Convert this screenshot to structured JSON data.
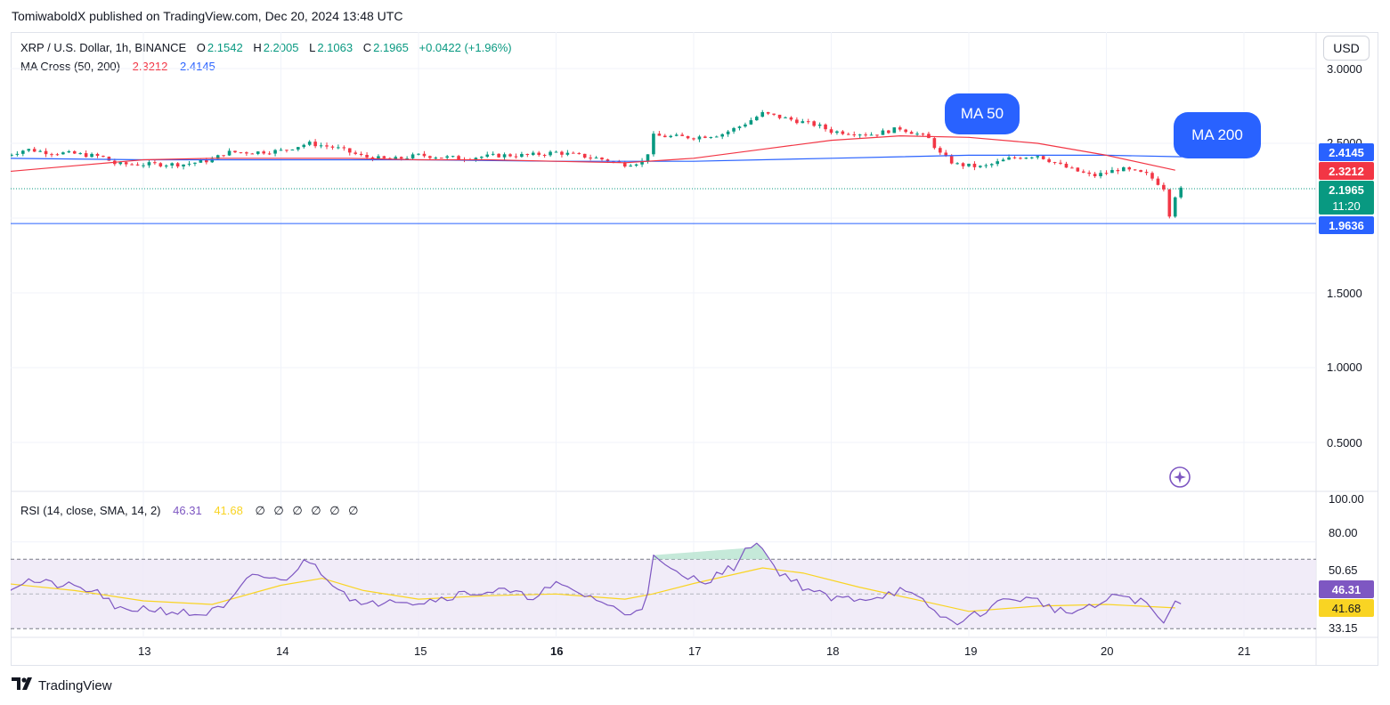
{
  "attribution": "TomiwaboldX published on TradingView.com, Dec 20, 2024 13:48 UTC",
  "header": {
    "symbol": "XRP / U.S. Dollar, 1h, BINANCE",
    "o_label": "O",
    "o_value": "2.1542",
    "h_label": "H",
    "h_value": "2.2005",
    "l_label": "L",
    "l_value": "2.1063",
    "c_label": "C",
    "c_value": "2.1965",
    "change": "+0.0422 (+1.96%)"
  },
  "ma_legend": {
    "label": "MA Cross (50, 200)",
    "ma50": "2.3212",
    "ma200": "2.4145"
  },
  "currency_button": "USD",
  "price_axis": [
    "3.0000",
    "2.5000",
    "1.5000",
    "1.0000",
    "0.5000"
  ],
  "price_tags": {
    "ma200": "2.4145",
    "ma50": "2.3212",
    "last": "2.1965",
    "countdown": "11:20",
    "line": "1.9636"
  },
  "bubbles": {
    "ma50": "MA 50",
    "ma200": "MA 200"
  },
  "rsi_legend": {
    "label": "RSI (14, close, SMA, 14, 2)",
    "rsi": "46.31",
    "sma": "41.68",
    "empties": "∅ ∅ ∅ ∅ ∅ ∅"
  },
  "rsi_axis": [
    "100.00",
    "80.00",
    "50.65",
    "33.15"
  ],
  "rsi_tags": {
    "rsi": "46.31",
    "sma": "41.68"
  },
  "time_axis": [
    "13",
    "14",
    "15",
    "16",
    "17",
    "18",
    "19",
    "20",
    "21"
  ],
  "footer_brand": "TradingView",
  "colors": {
    "up": "#089981",
    "down": "#f23645",
    "ma50": "#f23645",
    "ma200": "#2962ff",
    "rsi": "#7e57c2",
    "rsi_sma": "#f9d423",
    "rsi_band": "#ede7f6",
    "accent": "#2962ff"
  },
  "chart_data": {
    "type": "candlestick",
    "price_ylim": [
      0.25,
      3.1
    ],
    "rsi_ylim": [
      25,
      105
    ],
    "rsi_band": [
      30,
      70
    ],
    "x_start": "2024-12-12",
    "x_ticks": [
      "13",
      "14",
      "15",
      "16",
      "17",
      "18",
      "19",
      "20",
      "21"
    ],
    "horizontal_line": 1.9636,
    "ma50_series": [
      [
        12.0,
        2.31
      ],
      [
        12.5,
        2.35
      ],
      [
        13.0,
        2.39
      ],
      [
        13.5,
        2.4
      ],
      [
        14.0,
        2.4
      ],
      [
        14.5,
        2.4
      ],
      [
        15.0,
        2.39
      ],
      [
        15.5,
        2.39
      ],
      [
        16.0,
        2.38
      ],
      [
        16.5,
        2.37
      ],
      [
        17.0,
        2.4
      ],
      [
        17.5,
        2.46
      ],
      [
        18.0,
        2.52
      ],
      [
        18.5,
        2.55
      ],
      [
        19.0,
        2.54
      ],
      [
        19.5,
        2.5
      ],
      [
        20.0,
        2.42
      ],
      [
        20.5,
        2.32
      ]
    ],
    "ma200_series": [
      [
        12.0,
        2.4
      ],
      [
        13.0,
        2.39
      ],
      [
        14.0,
        2.39
      ],
      [
        15.0,
        2.39
      ],
      [
        16.0,
        2.38
      ],
      [
        17.0,
        2.38
      ],
      [
        18.0,
        2.4
      ],
      [
        19.0,
        2.42
      ],
      [
        20.0,
        2.42
      ],
      [
        20.55,
        2.41
      ]
    ],
    "price_path": [
      [
        12.0,
        2.42
      ],
      [
        12.15,
        2.46
      ],
      [
        12.3,
        2.44
      ],
      [
        12.5,
        2.43
      ],
      [
        12.7,
        2.41
      ],
      [
        12.8,
        2.36
      ],
      [
        13.0,
        2.36
      ],
      [
        13.3,
        2.36
      ],
      [
        13.5,
        2.39
      ],
      [
        13.6,
        2.44
      ],
      [
        13.8,
        2.44
      ],
      [
        14.0,
        2.45
      ],
      [
        14.2,
        2.5
      ],
      [
        14.4,
        2.47
      ],
      [
        14.6,
        2.41
      ],
      [
        14.8,
        2.39
      ],
      [
        15.0,
        2.42
      ],
      [
        15.3,
        2.4
      ],
      [
        15.6,
        2.42
      ],
      [
        15.8,
        2.42
      ],
      [
        16.0,
        2.44
      ],
      [
        16.3,
        2.4
      ],
      [
        16.5,
        2.36
      ],
      [
        16.65,
        2.38
      ],
      [
        16.7,
        2.55
      ],
      [
        17.0,
        2.54
      ],
      [
        17.2,
        2.56
      ],
      [
        17.35,
        2.62
      ],
      [
        17.5,
        2.7
      ],
      [
        17.7,
        2.66
      ],
      [
        17.9,
        2.62
      ],
      [
        18.0,
        2.58
      ],
      [
        18.3,
        2.56
      ],
      [
        18.5,
        2.6
      ],
      [
        18.7,
        2.54
      ],
      [
        18.8,
        2.42
      ],
      [
        18.9,
        2.36
      ],
      [
        19.1,
        2.34
      ],
      [
        19.3,
        2.4
      ],
      [
        19.5,
        2.42
      ],
      [
        19.7,
        2.34
      ],
      [
        19.9,
        2.28
      ],
      [
        20.1,
        2.33
      ],
      [
        20.3,
        2.29
      ],
      [
        20.42,
        2.2
      ],
      [
        20.45,
        2.0
      ],
      [
        20.5,
        2.15
      ],
      [
        20.55,
        2.2
      ]
    ],
    "rsi_path": [
      [
        12.0,
        52
      ],
      [
        12.15,
        58
      ],
      [
        12.3,
        56
      ],
      [
        12.5,
        54
      ],
      [
        12.7,
        50
      ],
      [
        12.8,
        40
      ],
      [
        13.0,
        42
      ],
      [
        13.2,
        40
      ],
      [
        13.4,
        38
      ],
      [
        13.6,
        42
      ],
      [
        13.8,
        62
      ],
      [
        14.0,
        57
      ],
      [
        14.2,
        70
      ],
      [
        14.4,
        55
      ],
      [
        14.6,
        42
      ],
      [
        14.8,
        48
      ],
      [
        15.0,
        45
      ],
      [
        15.3,
        50
      ],
      [
        15.6,
        52
      ],
      [
        15.8,
        48
      ],
      [
        16.0,
        55
      ],
      [
        16.3,
        47
      ],
      [
        16.5,
        38
      ],
      [
        16.65,
        44
      ],
      [
        16.7,
        71
      ],
      [
        16.9,
        60
      ],
      [
        17.1,
        58
      ],
      [
        17.3,
        66
      ],
      [
        17.45,
        82
      ],
      [
        17.6,
        64
      ],
      [
        17.8,
        54
      ],
      [
        18.0,
        47
      ],
      [
        18.3,
        48
      ],
      [
        18.5,
        52
      ],
      [
        18.7,
        44
      ],
      [
        18.8,
        36
      ],
      [
        18.95,
        34
      ],
      [
        19.1,
        40
      ],
      [
        19.3,
        48
      ],
      [
        19.5,
        46
      ],
      [
        19.7,
        39
      ],
      [
        19.9,
        42
      ],
      [
        20.1,
        50
      ],
      [
        20.3,
        44
      ],
      [
        20.42,
        32
      ],
      [
        20.48,
        44
      ],
      [
        20.55,
        47
      ]
    ],
    "rsi_sma_path": [
      [
        12.0,
        56
      ],
      [
        12.5,
        52
      ],
      [
        13.0,
        46
      ],
      [
        13.5,
        44
      ],
      [
        14.0,
        55
      ],
      [
        14.3,
        59
      ],
      [
        14.6,
        52
      ],
      [
        15.0,
        47
      ],
      [
        15.5,
        49
      ],
      [
        16.0,
        50
      ],
      [
        16.5,
        47
      ],
      [
        16.7,
        50
      ],
      [
        17.0,
        56
      ],
      [
        17.5,
        65
      ],
      [
        17.8,
        62
      ],
      [
        18.2,
        54
      ],
      [
        18.6,
        47
      ],
      [
        19.0,
        40
      ],
      [
        19.5,
        43
      ],
      [
        20.0,
        44
      ],
      [
        20.5,
        42
      ]
    ]
  }
}
